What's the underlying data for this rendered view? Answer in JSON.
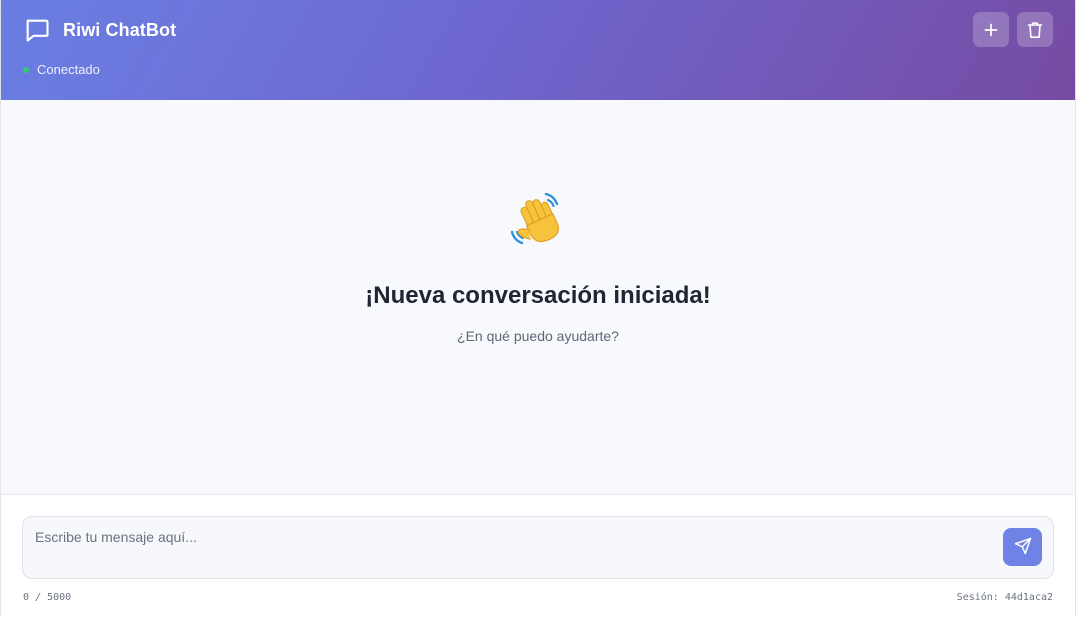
{
  "header": {
    "title": "Riwi ChatBot",
    "status": "Conectado",
    "status_color": "#2ecc71",
    "actions": [
      {
        "icon": "plus-icon"
      },
      {
        "icon": "trash-icon"
      }
    ],
    "gradient": [
      "#6a7fe3",
      "#764ba2"
    ]
  },
  "welcome": {
    "emoji": "waving-hand-icon",
    "title": "¡Nueva conversación iniciada!",
    "subtitle": "¿En qué puedo ayudarte?"
  },
  "composer": {
    "value": "",
    "placeholder": "Escribe tu mensaje aquí...",
    "send_icon": "send-icon",
    "char_count": "0 / 5000",
    "session": "Sesión: 44d1aca2"
  },
  "colors": {
    "accent": "#6f83e6",
    "background": "#f8f9fc"
  }
}
